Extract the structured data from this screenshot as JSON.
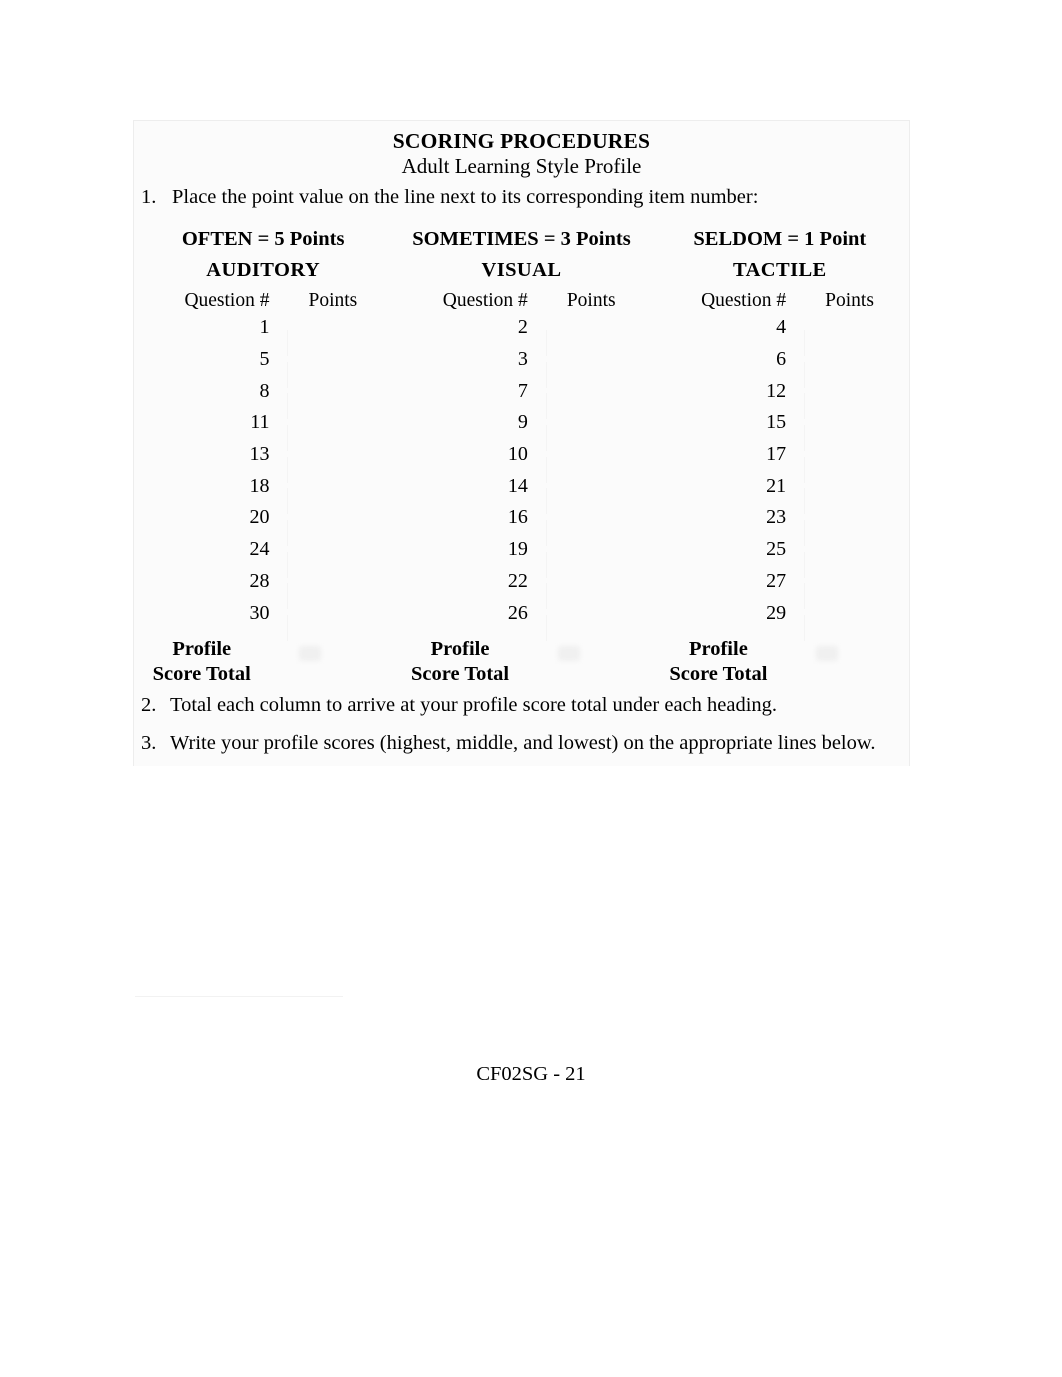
{
  "document": {
    "title": "SCORING PROCEDURES",
    "subtitle": "Adult Learning Style Profile",
    "footer": "CF02SG - 21"
  },
  "instructions": [
    {
      "number": "1.",
      "text": "Place the point value on the line next to its corresponding item number:"
    },
    {
      "number": "2.",
      "text": "Total each column to arrive at your profile score total under each heading."
    },
    {
      "number": "3.",
      "text": "Write your profile scores (highest, middle, and lowest) on the appropriate lines below."
    }
  ],
  "table": {
    "subheader_question": "Question #",
    "subheader_points": "Points",
    "total_label_line1": "Profile",
    "total_label_line2": "Score Total",
    "columns": [
      {
        "points_rule": "OFTEN = 5 Points",
        "style": "AUDITORY",
        "questions": [
          "1",
          "5",
          "8",
          "11",
          "13",
          "18",
          "20",
          "24",
          "28",
          "30"
        ],
        "points": [
          "",
          "",
          "",
          "",
          "",
          "",
          "",
          "",
          "",
          ""
        ],
        "total": ""
      },
      {
        "points_rule": "SOMETIMES = 3 Points",
        "style": "VISUAL",
        "questions": [
          "2",
          "3",
          "7",
          "9",
          "10",
          "14",
          "16",
          "19",
          "22",
          "26"
        ],
        "points": [
          "",
          "",
          "",
          "",
          "",
          "",
          "",
          "",
          "",
          ""
        ],
        "total": ""
      },
      {
        "points_rule": "SELDOM = 1 Point",
        "style": "TACTILE",
        "questions": [
          "4",
          "6",
          "12",
          "15",
          "17",
          "21",
          "23",
          "25",
          "27",
          "29"
        ],
        "points": [
          "",
          "",
          "",
          "",
          "",
          "",
          "",
          "",
          "",
          ""
        ],
        "total": ""
      }
    ]
  }
}
